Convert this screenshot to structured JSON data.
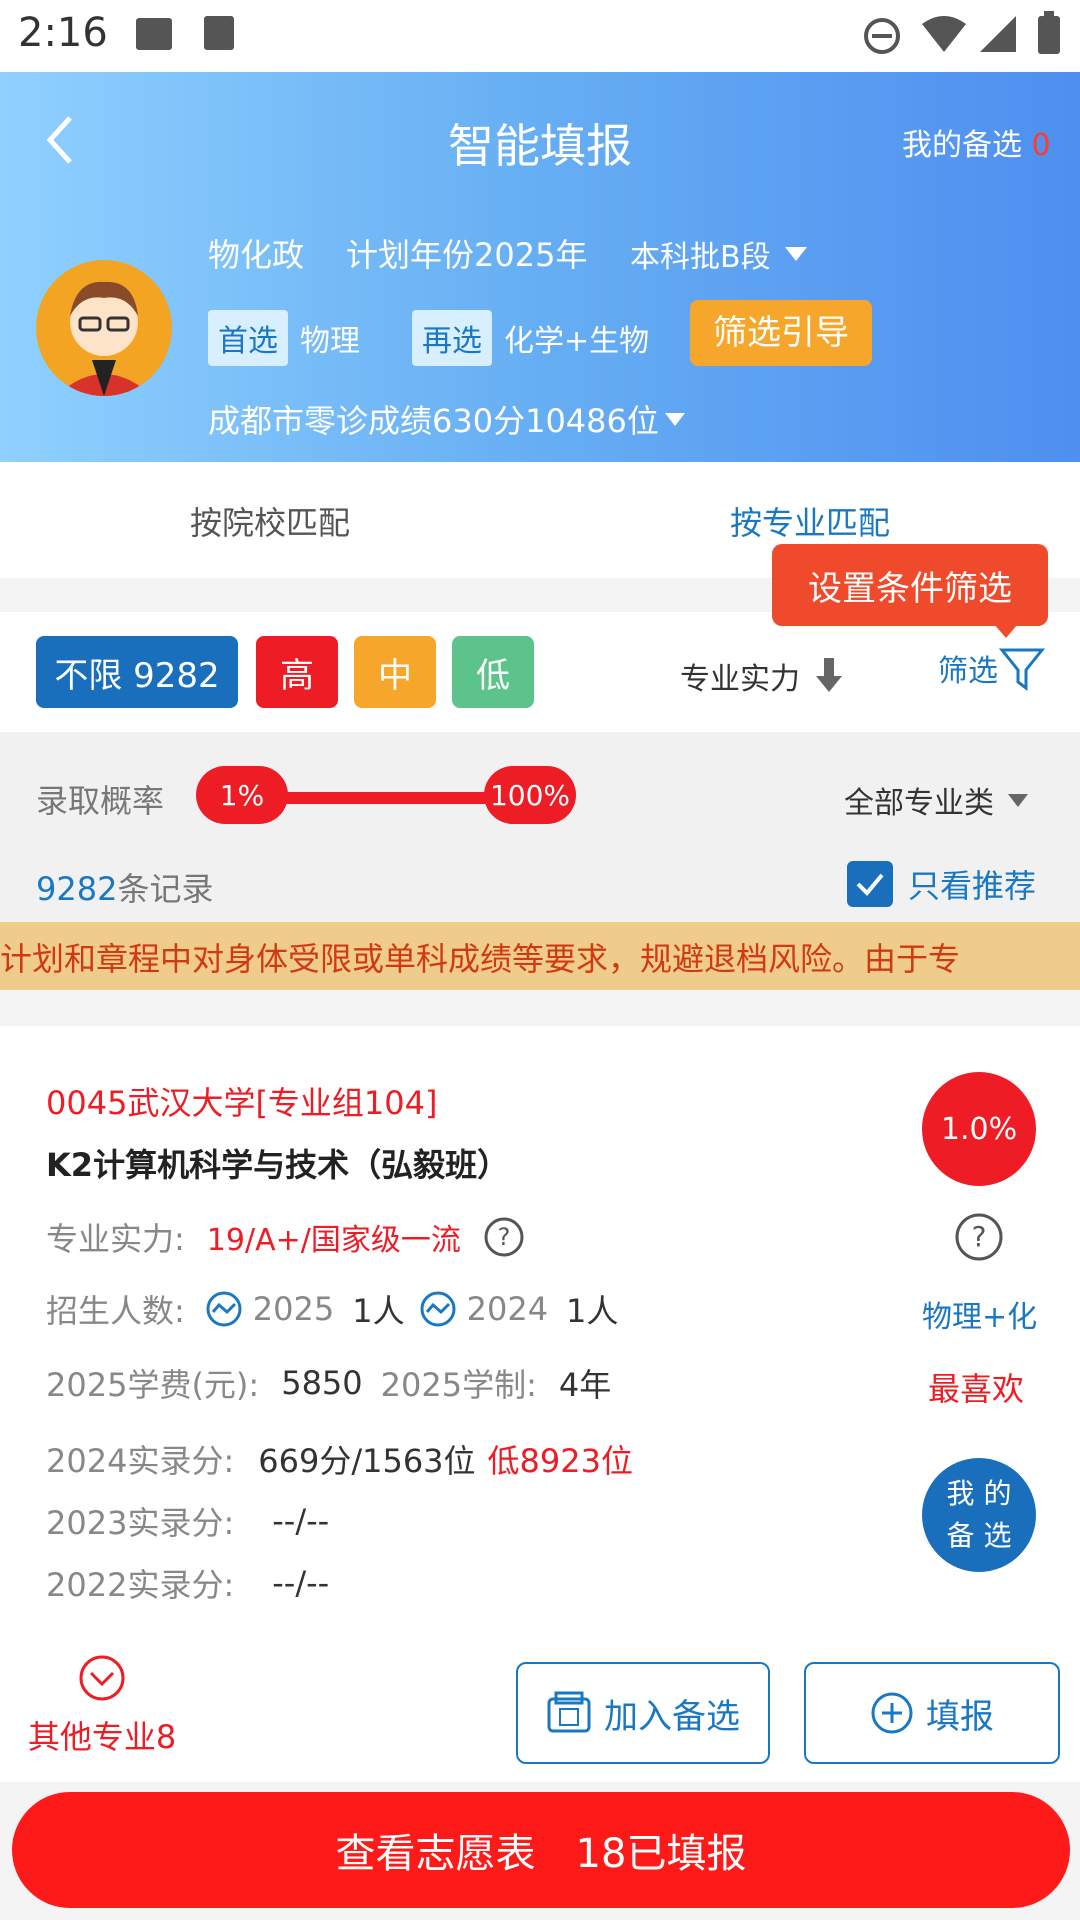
{
  "status": {
    "time": "2:16"
  },
  "header": {
    "title": "智能填报",
    "shortlist_label": "我的备选",
    "shortlist_count": "0",
    "subjects": "物化政",
    "plan_year": "计划年份2025年",
    "batch": "本科批B段",
    "first_choice_tag": "首选",
    "first_choice_value": "物理",
    "second_choice_tag": "再选",
    "second_choice_value": "化学+生物",
    "guide_button": "筛选引导",
    "score_info": "成都市零诊成绩630分10486位"
  },
  "tabs": [
    {
      "label": "按院校匹配",
      "active": false
    },
    {
      "label": "按专业匹配",
      "active": true
    }
  ],
  "tooltip": "设置条件筛选",
  "filters": {
    "all_label": "不限 9282",
    "high": "高",
    "mid": "中",
    "low": "低",
    "sort_label": "专业实力",
    "filter_label": "筛选"
  },
  "probability": {
    "label": "录取概率",
    "min": "1%",
    "max": "100%",
    "category": "全部专业类"
  },
  "records": {
    "count": "9282",
    "suffix": "条记录",
    "recommend_only": "只看推荐"
  },
  "notice": "计划和章程中对身体受限或单科成绩等要求，规避退档风险。由于专",
  "card": {
    "school": "0045武汉大学[专业组104]",
    "major": "K2计算机科学与技术（弘毅班）",
    "probability": "1.0%",
    "strength_label": "专业实力:",
    "strength_value": "19/A+/国家级一流",
    "enroll_label": "招生人数:",
    "enroll_year1": "2025",
    "enroll_count1": "1人",
    "enroll_year2": "2024",
    "enroll_count2": "1人",
    "subject_req": "物理+化",
    "tuition_label": "2025学费(元):",
    "tuition_value": "5850",
    "duration_label": "2025学制:",
    "duration_value": "4年",
    "favorite": "最喜欢",
    "score2024_label": "2024实录分:",
    "score2024_value": "669分/1563位",
    "score2024_diff": "低8923位",
    "score2023_label": "2023实录分:",
    "score2023_value": "--/--",
    "score2022_label": "2022实录分:",
    "score2022_value": "--/--",
    "other_majors": "其他专业8",
    "add_button": "加入备选",
    "apply_button": "填报",
    "float_line1": "我 的",
    "float_line2": "备 选"
  },
  "bottom": {
    "label": "查看志愿表　18已填报"
  },
  "colors": {
    "accent_red": "#ee1c25",
    "accent_blue": "#1a78c2",
    "orange": "#f6a62b",
    "green": "#5cc48a"
  }
}
